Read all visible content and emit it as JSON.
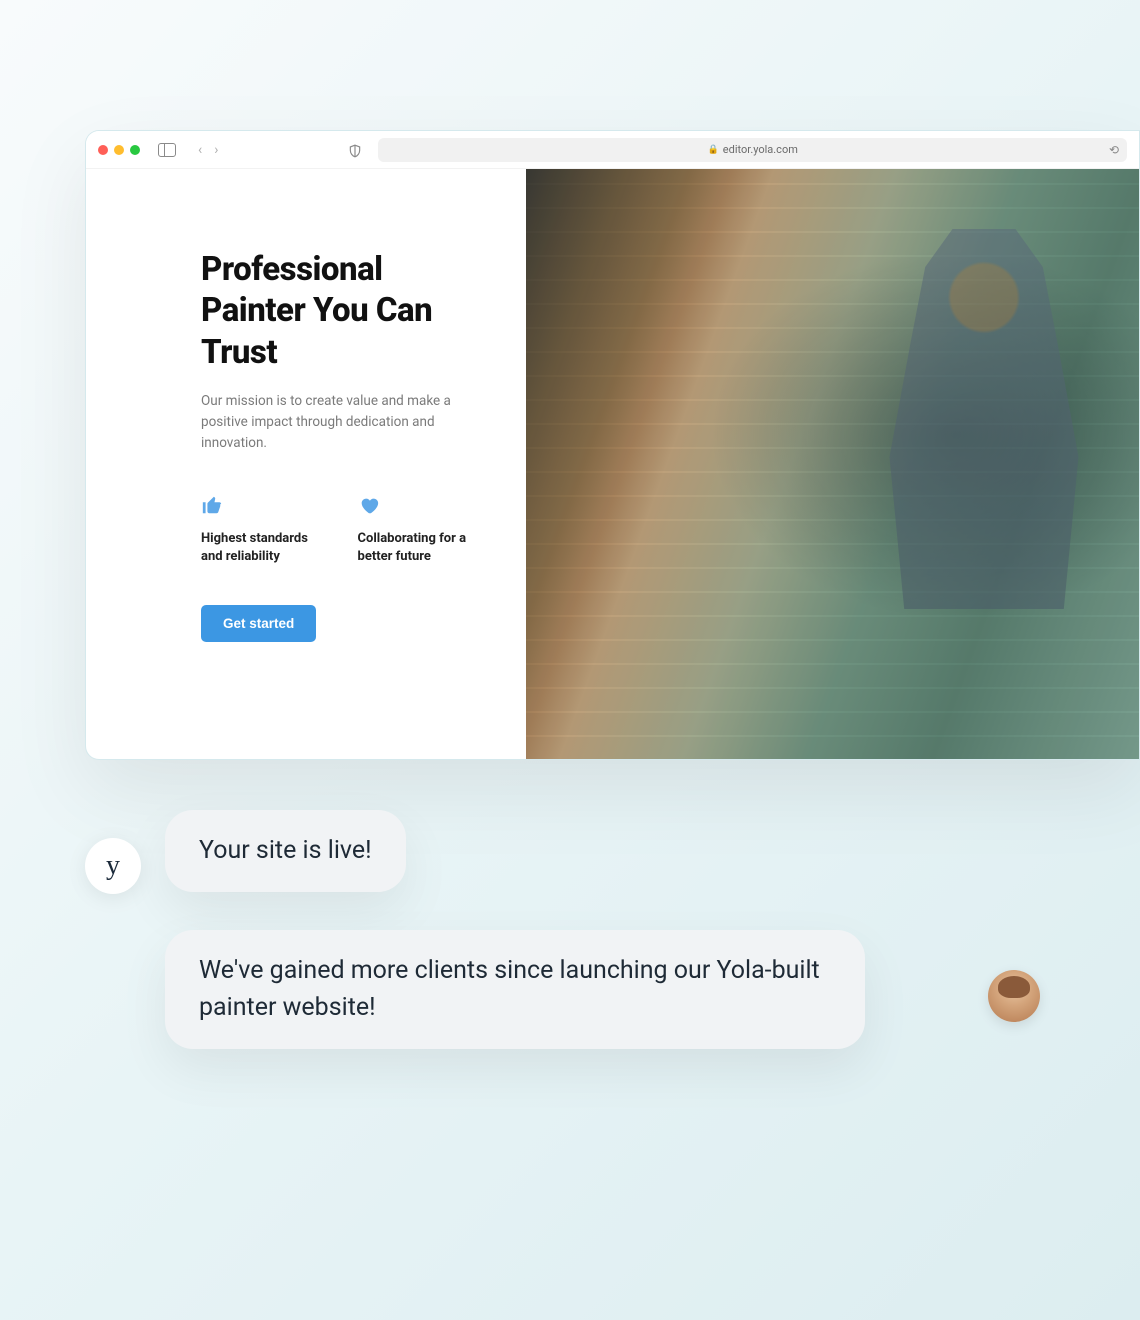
{
  "browser": {
    "url_display": "editor.yola.com"
  },
  "hero": {
    "title": "Professional Painter You Can Trust",
    "subtitle": "Our mission is to create value and make a positive impact through dedication and innovation.",
    "features": [
      {
        "icon": "thumbs-up-icon",
        "label": "Highest standards and reliability"
      },
      {
        "icon": "heart-icon",
        "label": "Collaborating for a better future"
      }
    ],
    "cta_label": "Get started"
  },
  "chat": {
    "yola_avatar_glyph": "y",
    "bubble1": "Your site is live!",
    "bubble2": "We've gained more clients since launching our Yola-built painter website!"
  },
  "colors": {
    "accent": "#3c97e3",
    "icon": "#5fa8e8"
  }
}
